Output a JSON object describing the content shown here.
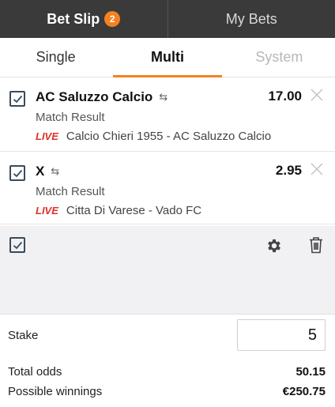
{
  "header": {
    "bet_slip_label": "Bet Slip",
    "bet_count": "2",
    "my_bets_label": "My Bets"
  },
  "subtabs": {
    "single": "Single",
    "multi": "Multi",
    "system": "System"
  },
  "bets": [
    {
      "selection": "AC Saluzzo Calcio",
      "odds": "17.00",
      "market": "Match Result",
      "live_label": "LIVE",
      "event": "Calcio Chieri 1955 - AC Saluzzo Calcio"
    },
    {
      "selection": "X",
      "odds": "2.95",
      "market": "Match Result",
      "live_label": "LIVE",
      "event": "Citta Di Varese - Vado FC"
    }
  ],
  "swap_glyph": "⇆",
  "stake": {
    "label": "Stake",
    "value": "5"
  },
  "summary": {
    "total_odds_label": "Total odds",
    "total_odds_value": "50.15",
    "winnings_label": "Possible winnings",
    "winnings_value": "€250.75"
  },
  "colors": {
    "accent": "#f5821f",
    "header_bg": "#3a3a3a",
    "live": "#e0302a"
  },
  "icons": [
    "checkbox-checked-icon",
    "swap-icon",
    "close-icon",
    "gear-icon",
    "trash-icon"
  ]
}
